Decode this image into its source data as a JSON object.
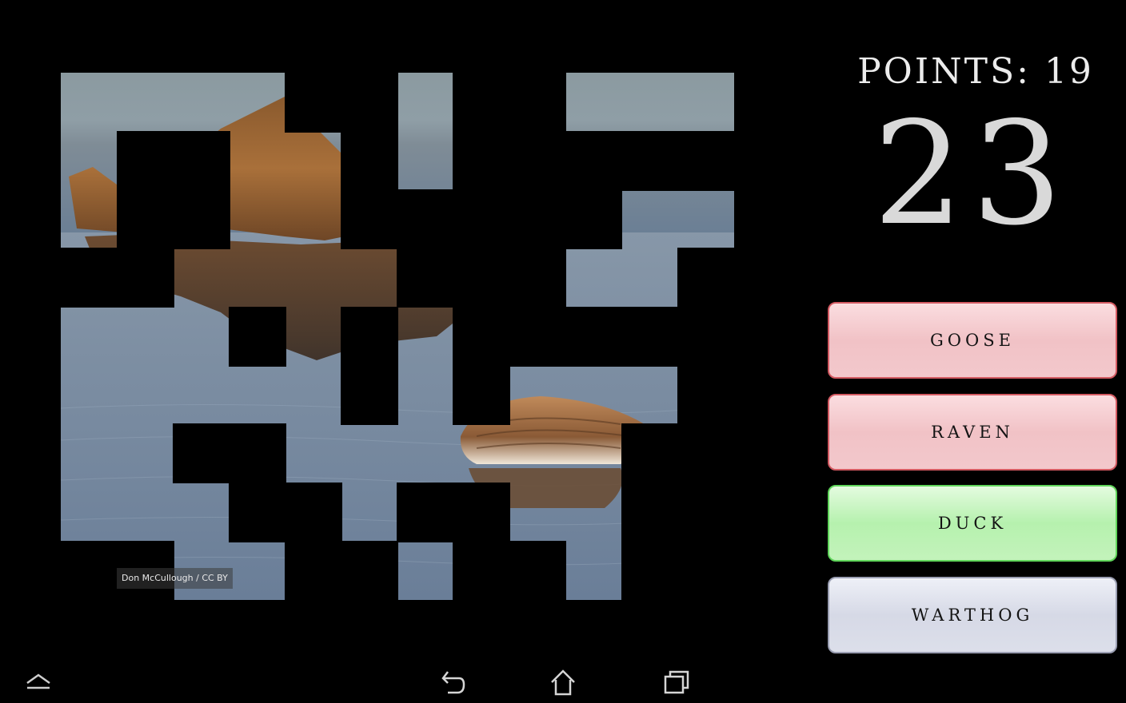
{
  "score": {
    "points_label": "POINTS:",
    "points_value": "19",
    "timer": "23"
  },
  "image": {
    "credit": "Don McCullough / CC BY"
  },
  "answers": [
    {
      "label": "GOOSE",
      "state": "red"
    },
    {
      "label": "RAVEN",
      "state": "red"
    },
    {
      "label": "DUCK",
      "state": "green"
    },
    {
      "label": "WARTHOG",
      "state": "neutral"
    }
  ],
  "colors": {
    "wrong_answer": "#f1c2c6",
    "correct_answer": "#b6f1ae",
    "neutral_answer": "#d6d9e6",
    "background": "#000000"
  },
  "nav": {
    "icons": [
      "hide-keyboard-icon",
      "back-icon",
      "home-icon",
      "recent-apps-icon"
    ]
  }
}
